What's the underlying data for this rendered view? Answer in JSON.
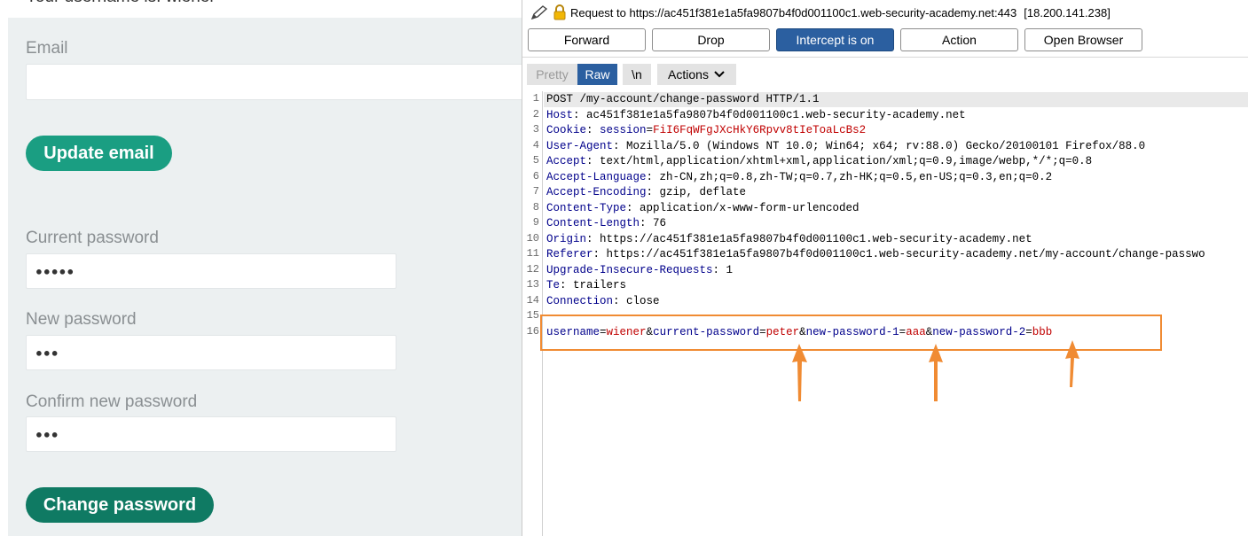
{
  "left": {
    "truncated_heading": "Your username is: wiener",
    "email_label": "Email",
    "email_value": "",
    "update_email_button": "Update email",
    "current_password_label": "Current password",
    "current_password_mask": "●●●●●",
    "new_password_label": "New password",
    "new_password_mask": "●●●",
    "confirm_password_label": "Confirm new password",
    "confirm_password_mask": "●●●",
    "change_password_button": "Change password",
    "button_color": "#1a9e82",
    "button_dark_color": "#0f7a63"
  },
  "burp": {
    "request_label": "Request to https://ac451f381e1a5fa9807b4f0d001100c1.web-security-academy.net:443",
    "ip": "[18.200.141.238]",
    "buttons": [
      "Forward",
      "Drop",
      "Intercept is on",
      "Action",
      "Open Browser"
    ],
    "tabs": {
      "pretty": "Pretty",
      "raw": "Raw",
      "newline": "\\n",
      "actions": "Actions"
    },
    "accent_color": "#2b5fa0",
    "highlight_color": "#f08b33",
    "lines": [
      {
        "n": "1",
        "key": "",
        "rest": "POST /my-account/change-password HTTP/1.1"
      },
      {
        "n": "2",
        "key": "Host",
        "rest": ": ac451f381e1a5fa9807b4f0d001100c1.web-security-academy.net"
      },
      {
        "n": "3",
        "key": "Cookie",
        "rest": ": "
      },
      {
        "n": "4",
        "key": "User-Agent",
        "rest": ": Mozilla/5.0 (Windows NT 10.0; Win64; x64; rv:88.0) Gecko/20100101 Firefox/88.0"
      },
      {
        "n": "5",
        "key": "Accept",
        "rest": ": text/html,application/xhtml+xml,application/xml;q=0.9,image/webp,*/*;q=0.8"
      },
      {
        "n": "6",
        "key": "Accept-Language",
        "rest": ": zh-CN,zh;q=0.8,zh-TW;q=0.7,zh-HK;q=0.5,en-US;q=0.3,en;q=0.2"
      },
      {
        "n": "7",
        "key": "Accept-Encoding",
        "rest": ": gzip, deflate"
      },
      {
        "n": "8",
        "key": "Content-Type",
        "rest": ": application/x-www-form-urlencoded"
      },
      {
        "n": "9",
        "key": "Content-Length",
        "rest": ": 76"
      },
      {
        "n": "10",
        "key": "Origin",
        "rest": ": https://ac451f381e1a5fa9807b4f0d001100c1.web-security-academy.net"
      },
      {
        "n": "11",
        "key": "Referer",
        "rest": ": https://ac451f381e1a5fa9807b4f0d001100c1.web-security-academy.net/my-account/change-passwo"
      },
      {
        "n": "12",
        "key": "Upgrade-Insecure-Requests",
        "rest": ": 1"
      },
      {
        "n": "13",
        "key": "Te",
        "rest": ": trailers"
      },
      {
        "n": "14",
        "key": "Connection",
        "rest": ": close"
      },
      {
        "n": "15",
        "key": "",
        "rest": ""
      }
    ],
    "cookie_name": "session",
    "cookie_value": "FiI6FqWFgJXcHkY6Rpvv8tIeToaLcBs2",
    "body_line_number": "16",
    "body_params": [
      {
        "key": "username",
        "value": "wiener"
      },
      {
        "key": "current-password",
        "value": "peter"
      },
      {
        "key": "new-password-1",
        "value": "aaa"
      },
      {
        "key": "new-password-2",
        "value": "bbb"
      }
    ]
  }
}
